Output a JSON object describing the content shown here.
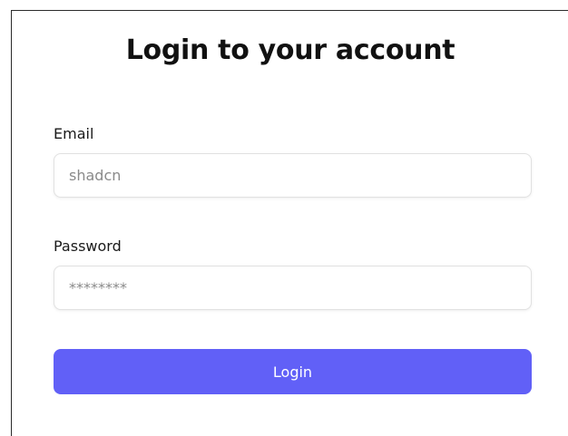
{
  "login_form": {
    "title": "Login to your account",
    "email": {
      "label": "Email",
      "placeholder": "shadcn",
      "value": ""
    },
    "password": {
      "label": "Password",
      "placeholder": "********",
      "value": ""
    },
    "submit_label": "Login"
  },
  "colors": {
    "accent": "#6160f7",
    "card_border": "#2b2b2b",
    "input_border": "#e1e1e1",
    "title_text": "#111111",
    "placeholder_text": "#8a8a8a"
  }
}
